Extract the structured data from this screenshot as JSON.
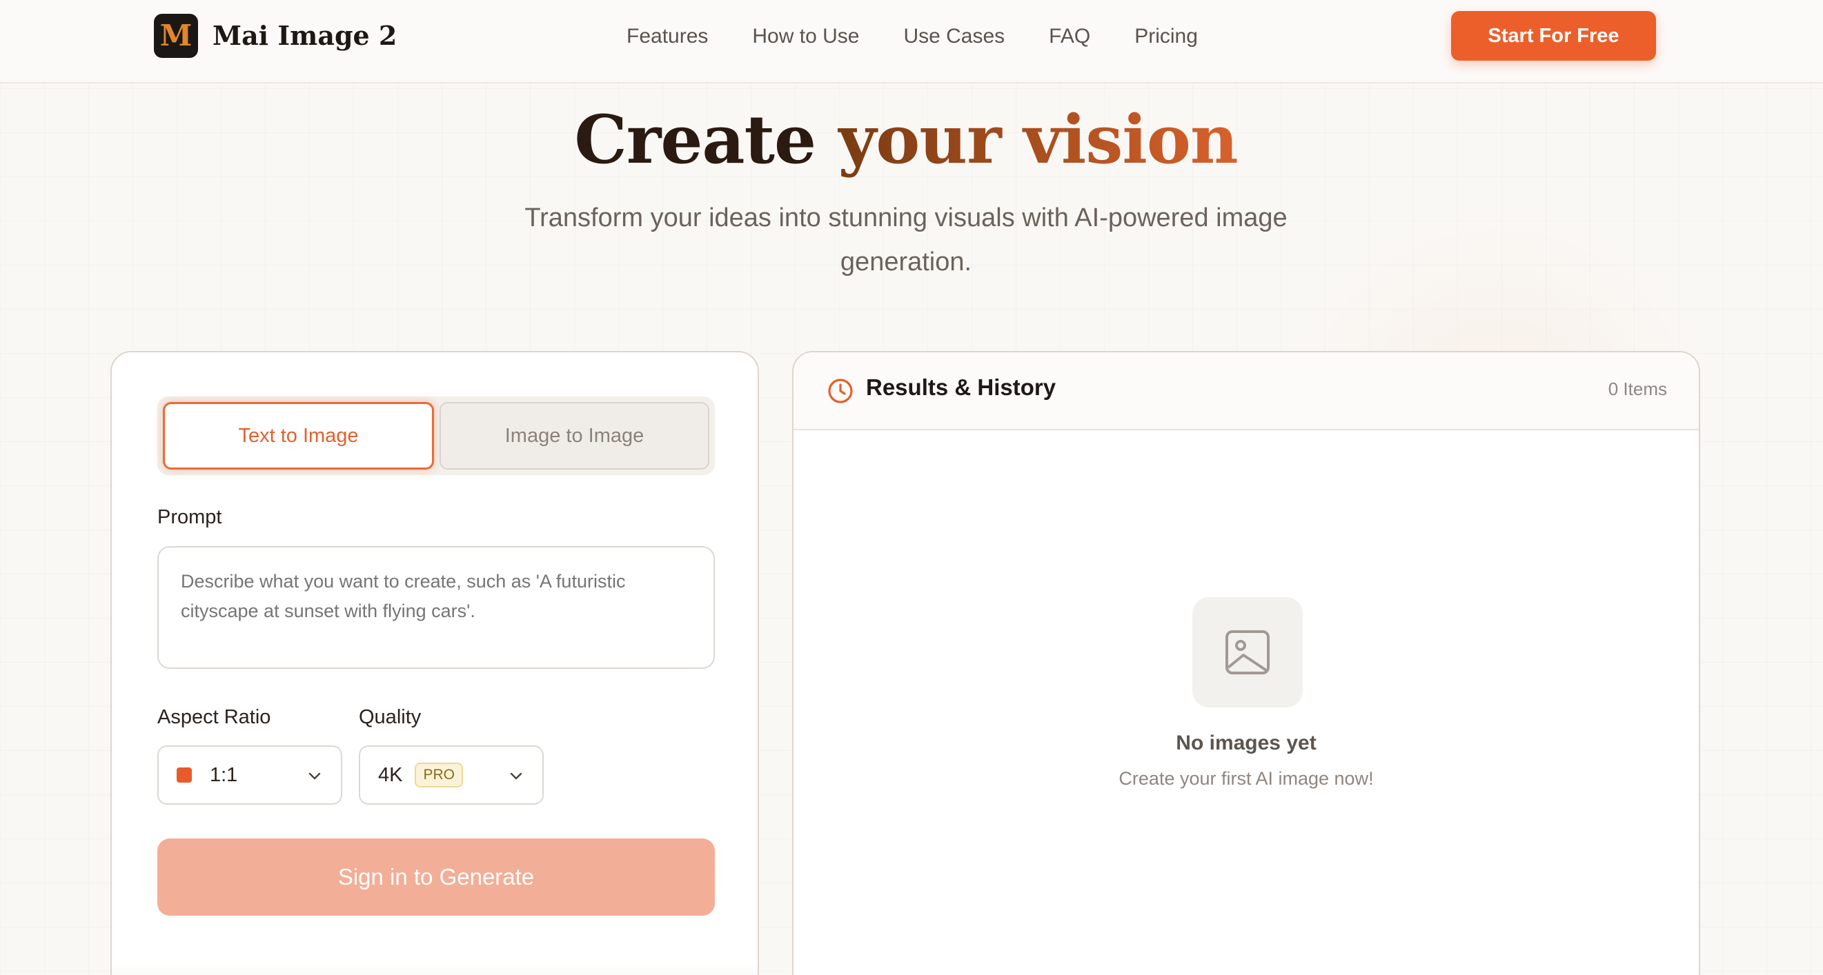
{
  "brand": {
    "logo_letter": "M",
    "name": "Mai Image 2"
  },
  "nav": {
    "items": [
      {
        "label": "Features"
      },
      {
        "label": "How to Use"
      },
      {
        "label": "Use Cases"
      },
      {
        "label": "FAQ"
      },
      {
        "label": "Pricing"
      }
    ],
    "cta_label": "Start For Free"
  },
  "hero": {
    "title_part1": "Create",
    "title_part2": "your vision",
    "subtitle": "Transform your ideas into stunning visuals with AI-powered image generation."
  },
  "generator": {
    "tabs": [
      {
        "label": "Text to Image",
        "active": true
      },
      {
        "label": "Image to Image",
        "active": false
      }
    ],
    "prompt_label": "Prompt",
    "prompt_placeholder": "Describe what you want to create, such as 'A futuristic cityscape at sunset with flying cars'.",
    "aspect_label": "Aspect Ratio",
    "aspect_value": "1:1",
    "quality_label": "Quality",
    "quality_value": "4K",
    "quality_badge": "PRO",
    "generate_label": "Sign in to Generate"
  },
  "results": {
    "title": "Results & History",
    "count": "0 Items",
    "empty_title": "No images yet",
    "empty_subtitle": "Create your first AI image now!"
  },
  "colors": {
    "accent": "#ec5f2b",
    "accent_soft": "#f3ae97",
    "background": "#faf8f5"
  },
  "icons": {
    "results": "clock-icon",
    "empty": "image-placeholder-icon",
    "dropdown": "chevron-down-icon"
  }
}
